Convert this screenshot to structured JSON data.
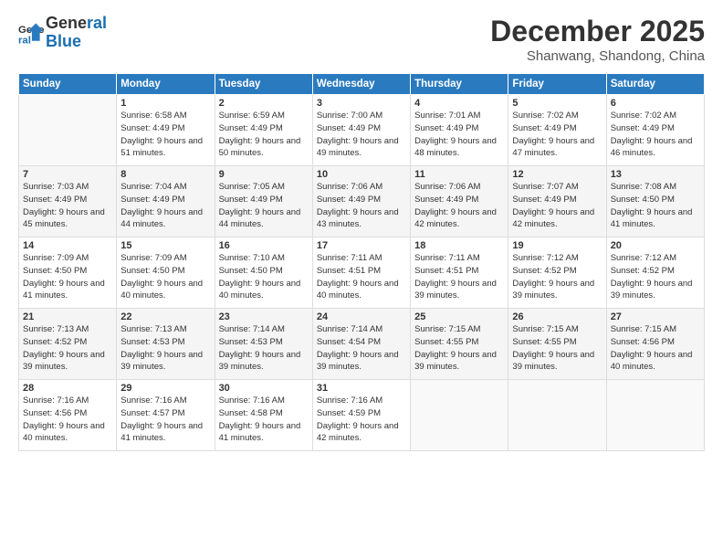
{
  "logo": {
    "line1": "General",
    "line2": "Blue"
  },
  "title": "December 2025",
  "location": "Shanwang, Shandong, China",
  "days_header": [
    "Sunday",
    "Monday",
    "Tuesday",
    "Wednesday",
    "Thursday",
    "Friday",
    "Saturday"
  ],
  "weeks": [
    [
      {
        "day": "",
        "sunrise": "",
        "sunset": "",
        "daylight": "",
        "empty": true
      },
      {
        "day": "1",
        "sunrise": "Sunrise: 6:58 AM",
        "sunset": "Sunset: 4:49 PM",
        "daylight": "Daylight: 9 hours and 51 minutes."
      },
      {
        "day": "2",
        "sunrise": "Sunrise: 6:59 AM",
        "sunset": "Sunset: 4:49 PM",
        "daylight": "Daylight: 9 hours and 50 minutes."
      },
      {
        "day": "3",
        "sunrise": "Sunrise: 7:00 AM",
        "sunset": "Sunset: 4:49 PM",
        "daylight": "Daylight: 9 hours and 49 minutes."
      },
      {
        "day": "4",
        "sunrise": "Sunrise: 7:01 AM",
        "sunset": "Sunset: 4:49 PM",
        "daylight": "Daylight: 9 hours and 48 minutes."
      },
      {
        "day": "5",
        "sunrise": "Sunrise: 7:02 AM",
        "sunset": "Sunset: 4:49 PM",
        "daylight": "Daylight: 9 hours and 47 minutes."
      },
      {
        "day": "6",
        "sunrise": "Sunrise: 7:02 AM",
        "sunset": "Sunset: 4:49 PM",
        "daylight": "Daylight: 9 hours and 46 minutes."
      }
    ],
    [
      {
        "day": "7",
        "sunrise": "Sunrise: 7:03 AM",
        "sunset": "Sunset: 4:49 PM",
        "daylight": "Daylight: 9 hours and 45 minutes."
      },
      {
        "day": "8",
        "sunrise": "Sunrise: 7:04 AM",
        "sunset": "Sunset: 4:49 PM",
        "daylight": "Daylight: 9 hours and 44 minutes."
      },
      {
        "day": "9",
        "sunrise": "Sunrise: 7:05 AM",
        "sunset": "Sunset: 4:49 PM",
        "daylight": "Daylight: 9 hours and 44 minutes."
      },
      {
        "day": "10",
        "sunrise": "Sunrise: 7:06 AM",
        "sunset": "Sunset: 4:49 PM",
        "daylight": "Daylight: 9 hours and 43 minutes."
      },
      {
        "day": "11",
        "sunrise": "Sunrise: 7:06 AM",
        "sunset": "Sunset: 4:49 PM",
        "daylight": "Daylight: 9 hours and 42 minutes."
      },
      {
        "day": "12",
        "sunrise": "Sunrise: 7:07 AM",
        "sunset": "Sunset: 4:49 PM",
        "daylight": "Daylight: 9 hours and 42 minutes."
      },
      {
        "day": "13",
        "sunrise": "Sunrise: 7:08 AM",
        "sunset": "Sunset: 4:50 PM",
        "daylight": "Daylight: 9 hours and 41 minutes."
      }
    ],
    [
      {
        "day": "14",
        "sunrise": "Sunrise: 7:09 AM",
        "sunset": "Sunset: 4:50 PM",
        "daylight": "Daylight: 9 hours and 41 minutes."
      },
      {
        "day": "15",
        "sunrise": "Sunrise: 7:09 AM",
        "sunset": "Sunset: 4:50 PM",
        "daylight": "Daylight: 9 hours and 40 minutes."
      },
      {
        "day": "16",
        "sunrise": "Sunrise: 7:10 AM",
        "sunset": "Sunset: 4:50 PM",
        "daylight": "Daylight: 9 hours and 40 minutes."
      },
      {
        "day": "17",
        "sunrise": "Sunrise: 7:11 AM",
        "sunset": "Sunset: 4:51 PM",
        "daylight": "Daylight: 9 hours and 40 minutes."
      },
      {
        "day": "18",
        "sunrise": "Sunrise: 7:11 AM",
        "sunset": "Sunset: 4:51 PM",
        "daylight": "Daylight: 9 hours and 39 minutes."
      },
      {
        "day": "19",
        "sunrise": "Sunrise: 7:12 AM",
        "sunset": "Sunset: 4:52 PM",
        "daylight": "Daylight: 9 hours and 39 minutes."
      },
      {
        "day": "20",
        "sunrise": "Sunrise: 7:12 AM",
        "sunset": "Sunset: 4:52 PM",
        "daylight": "Daylight: 9 hours and 39 minutes."
      }
    ],
    [
      {
        "day": "21",
        "sunrise": "Sunrise: 7:13 AM",
        "sunset": "Sunset: 4:52 PM",
        "daylight": "Daylight: 9 hours and 39 minutes."
      },
      {
        "day": "22",
        "sunrise": "Sunrise: 7:13 AM",
        "sunset": "Sunset: 4:53 PM",
        "daylight": "Daylight: 9 hours and 39 minutes."
      },
      {
        "day": "23",
        "sunrise": "Sunrise: 7:14 AM",
        "sunset": "Sunset: 4:53 PM",
        "daylight": "Daylight: 9 hours and 39 minutes."
      },
      {
        "day": "24",
        "sunrise": "Sunrise: 7:14 AM",
        "sunset": "Sunset: 4:54 PM",
        "daylight": "Daylight: 9 hours and 39 minutes."
      },
      {
        "day": "25",
        "sunrise": "Sunrise: 7:15 AM",
        "sunset": "Sunset: 4:55 PM",
        "daylight": "Daylight: 9 hours and 39 minutes."
      },
      {
        "day": "26",
        "sunrise": "Sunrise: 7:15 AM",
        "sunset": "Sunset: 4:55 PM",
        "daylight": "Daylight: 9 hours and 39 minutes."
      },
      {
        "day": "27",
        "sunrise": "Sunrise: 7:15 AM",
        "sunset": "Sunset: 4:56 PM",
        "daylight": "Daylight: 9 hours and 40 minutes."
      }
    ],
    [
      {
        "day": "28",
        "sunrise": "Sunrise: 7:16 AM",
        "sunset": "Sunset: 4:56 PM",
        "daylight": "Daylight: 9 hours and 40 minutes."
      },
      {
        "day": "29",
        "sunrise": "Sunrise: 7:16 AM",
        "sunset": "Sunset: 4:57 PM",
        "daylight": "Daylight: 9 hours and 41 minutes."
      },
      {
        "day": "30",
        "sunrise": "Sunrise: 7:16 AM",
        "sunset": "Sunset: 4:58 PM",
        "daylight": "Daylight: 9 hours and 41 minutes."
      },
      {
        "day": "31",
        "sunrise": "Sunrise: 7:16 AM",
        "sunset": "Sunset: 4:59 PM",
        "daylight": "Daylight: 9 hours and 42 minutes."
      },
      {
        "day": "",
        "sunrise": "",
        "sunset": "",
        "daylight": "",
        "empty": true
      },
      {
        "day": "",
        "sunrise": "",
        "sunset": "",
        "daylight": "",
        "empty": true
      },
      {
        "day": "",
        "sunrise": "",
        "sunset": "",
        "daylight": "",
        "empty": true
      }
    ]
  ]
}
